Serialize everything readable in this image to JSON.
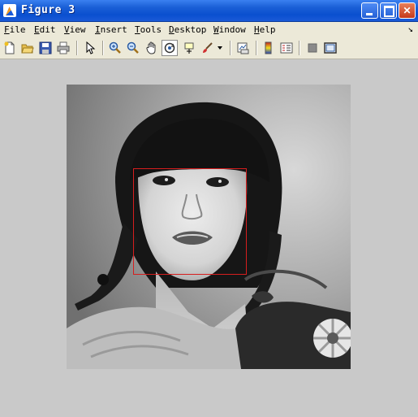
{
  "window": {
    "title": "Figure 3"
  },
  "menu": {
    "items": [
      {
        "key": "F",
        "rest": "ile"
      },
      {
        "key": "E",
        "rest": "dit"
      },
      {
        "key": "V",
        "rest": "iew"
      },
      {
        "key": "I",
        "rest": "nsert"
      },
      {
        "key": "T",
        "rest": "ools"
      },
      {
        "key": "D",
        "rest": "esktop"
      },
      {
        "key": "W",
        "rest": "indow"
      },
      {
        "key": "H",
        "rest": "elp"
      }
    ],
    "dock_glyph": "↘"
  },
  "toolbar": {
    "icons": [
      "new-figure-icon",
      "open-file-icon",
      "save-icon",
      "print-icon",
      "pointer-icon",
      "zoom-in-icon",
      "zoom-out-icon",
      "pan-hand-icon",
      "rotate-3d-icon",
      "data-cursor-icon",
      "brush-icon",
      "dropdown-arrow-icon",
      "link-plot-icon",
      "colorbar-icon",
      "legend-icon",
      "hide-plot-tools-icon",
      "show-plot-tools-icon"
    ]
  },
  "figure": {
    "image_description_hidden": "",
    "detection_box_color": "#d61e1e"
  },
  "colors": {
    "titlebar": "#0a4fcf",
    "menubar": "#ece9d8",
    "figure_bg": "#c9c9c9"
  }
}
